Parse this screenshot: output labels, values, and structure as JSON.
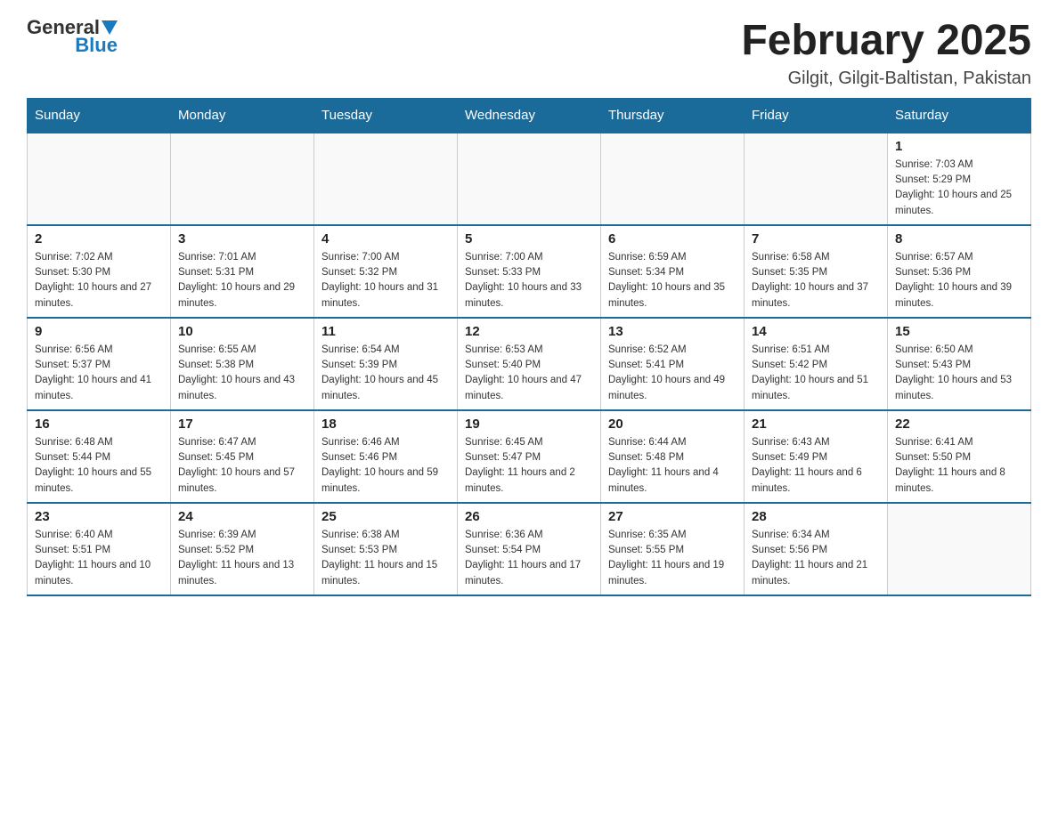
{
  "header": {
    "logo": {
      "general": "General",
      "blue": "Blue"
    },
    "title": "February 2025",
    "location": "Gilgit, Gilgit-Baltistan, Pakistan"
  },
  "days_of_week": [
    "Sunday",
    "Monday",
    "Tuesday",
    "Wednesday",
    "Thursday",
    "Friday",
    "Saturday"
  ],
  "weeks": [
    [
      {
        "day": "",
        "info": ""
      },
      {
        "day": "",
        "info": ""
      },
      {
        "day": "",
        "info": ""
      },
      {
        "day": "",
        "info": ""
      },
      {
        "day": "",
        "info": ""
      },
      {
        "day": "",
        "info": ""
      },
      {
        "day": "1",
        "info": "Sunrise: 7:03 AM\nSunset: 5:29 PM\nDaylight: 10 hours and 25 minutes."
      }
    ],
    [
      {
        "day": "2",
        "info": "Sunrise: 7:02 AM\nSunset: 5:30 PM\nDaylight: 10 hours and 27 minutes."
      },
      {
        "day": "3",
        "info": "Sunrise: 7:01 AM\nSunset: 5:31 PM\nDaylight: 10 hours and 29 minutes."
      },
      {
        "day": "4",
        "info": "Sunrise: 7:00 AM\nSunset: 5:32 PM\nDaylight: 10 hours and 31 minutes."
      },
      {
        "day": "5",
        "info": "Sunrise: 7:00 AM\nSunset: 5:33 PM\nDaylight: 10 hours and 33 minutes."
      },
      {
        "day": "6",
        "info": "Sunrise: 6:59 AM\nSunset: 5:34 PM\nDaylight: 10 hours and 35 minutes."
      },
      {
        "day": "7",
        "info": "Sunrise: 6:58 AM\nSunset: 5:35 PM\nDaylight: 10 hours and 37 minutes."
      },
      {
        "day": "8",
        "info": "Sunrise: 6:57 AM\nSunset: 5:36 PM\nDaylight: 10 hours and 39 minutes."
      }
    ],
    [
      {
        "day": "9",
        "info": "Sunrise: 6:56 AM\nSunset: 5:37 PM\nDaylight: 10 hours and 41 minutes."
      },
      {
        "day": "10",
        "info": "Sunrise: 6:55 AM\nSunset: 5:38 PM\nDaylight: 10 hours and 43 minutes."
      },
      {
        "day": "11",
        "info": "Sunrise: 6:54 AM\nSunset: 5:39 PM\nDaylight: 10 hours and 45 minutes."
      },
      {
        "day": "12",
        "info": "Sunrise: 6:53 AM\nSunset: 5:40 PM\nDaylight: 10 hours and 47 minutes."
      },
      {
        "day": "13",
        "info": "Sunrise: 6:52 AM\nSunset: 5:41 PM\nDaylight: 10 hours and 49 minutes."
      },
      {
        "day": "14",
        "info": "Sunrise: 6:51 AM\nSunset: 5:42 PM\nDaylight: 10 hours and 51 minutes."
      },
      {
        "day": "15",
        "info": "Sunrise: 6:50 AM\nSunset: 5:43 PM\nDaylight: 10 hours and 53 minutes."
      }
    ],
    [
      {
        "day": "16",
        "info": "Sunrise: 6:48 AM\nSunset: 5:44 PM\nDaylight: 10 hours and 55 minutes."
      },
      {
        "day": "17",
        "info": "Sunrise: 6:47 AM\nSunset: 5:45 PM\nDaylight: 10 hours and 57 minutes."
      },
      {
        "day": "18",
        "info": "Sunrise: 6:46 AM\nSunset: 5:46 PM\nDaylight: 10 hours and 59 minutes."
      },
      {
        "day": "19",
        "info": "Sunrise: 6:45 AM\nSunset: 5:47 PM\nDaylight: 11 hours and 2 minutes."
      },
      {
        "day": "20",
        "info": "Sunrise: 6:44 AM\nSunset: 5:48 PM\nDaylight: 11 hours and 4 minutes."
      },
      {
        "day": "21",
        "info": "Sunrise: 6:43 AM\nSunset: 5:49 PM\nDaylight: 11 hours and 6 minutes."
      },
      {
        "day": "22",
        "info": "Sunrise: 6:41 AM\nSunset: 5:50 PM\nDaylight: 11 hours and 8 minutes."
      }
    ],
    [
      {
        "day": "23",
        "info": "Sunrise: 6:40 AM\nSunset: 5:51 PM\nDaylight: 11 hours and 10 minutes."
      },
      {
        "day": "24",
        "info": "Sunrise: 6:39 AM\nSunset: 5:52 PM\nDaylight: 11 hours and 13 minutes."
      },
      {
        "day": "25",
        "info": "Sunrise: 6:38 AM\nSunset: 5:53 PM\nDaylight: 11 hours and 15 minutes."
      },
      {
        "day": "26",
        "info": "Sunrise: 6:36 AM\nSunset: 5:54 PM\nDaylight: 11 hours and 17 minutes."
      },
      {
        "day": "27",
        "info": "Sunrise: 6:35 AM\nSunset: 5:55 PM\nDaylight: 11 hours and 19 minutes."
      },
      {
        "day": "28",
        "info": "Sunrise: 6:34 AM\nSunset: 5:56 PM\nDaylight: 11 hours and 21 minutes."
      },
      {
        "day": "",
        "info": ""
      }
    ]
  ]
}
